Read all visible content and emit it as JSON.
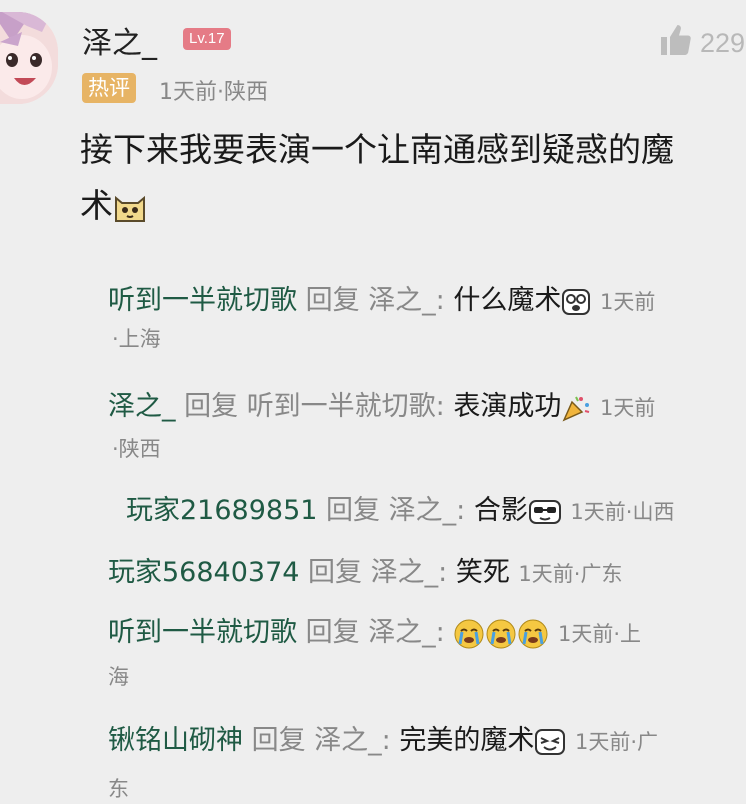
{
  "comment": {
    "username": "泽之_",
    "level": "Lv.17",
    "like_count": "229",
    "hot_badge": "热评",
    "meta": "1天前·陕西",
    "content_line1": "接下来我要表演一个让南通感到疑惑的魔",
    "content_line2": "术"
  },
  "replies": [
    {
      "user": "听到一半就切歌",
      "reply_word": "回复",
      "target": "泽之_:",
      "text": "什么魔术",
      "time": "1天前",
      "time_cont": "·上海"
    },
    {
      "user": "泽之_",
      "reply_word": "回复",
      "target": "听到一半就切歌:",
      "text": "表演成功",
      "time": "1天前",
      "time_cont": "·陕西"
    },
    {
      "user": "玩家21689851",
      "reply_word": "回复",
      "target": "泽之_:",
      "text": "合影",
      "time": "1天前·山西"
    },
    {
      "user": "玩家56840374",
      "reply_word": "回复",
      "target": "泽之_:",
      "text": "笑死",
      "time": "1天前·广东"
    },
    {
      "user": "听到一半就切歌",
      "reply_word": "回复",
      "target": "泽之_:",
      "text": "",
      "time": "1天前·上",
      "time_cont": "海"
    },
    {
      "user": "锹铭山砌神",
      "reply_word": "回复",
      "target": "泽之_:",
      "text": "完美的魔术",
      "time": "1天前·广",
      "time_cont": "东"
    }
  ],
  "icons": {
    "like": "thumbs-up-icon",
    "cat": "cat-emoji-icon",
    "shocked": "shocked-emoji-icon",
    "party": "party-popper-emoji-icon",
    "sunglasses": "sunglasses-emoji-icon",
    "crying": "crying-emoji-icon",
    "laughing": "laughing-emoji-icon"
  },
  "colors": {
    "username_green": "#1f5a44",
    "level_pink": "#e57b86",
    "hot_orange": "#e7b465",
    "meta_gray": "#888888"
  }
}
